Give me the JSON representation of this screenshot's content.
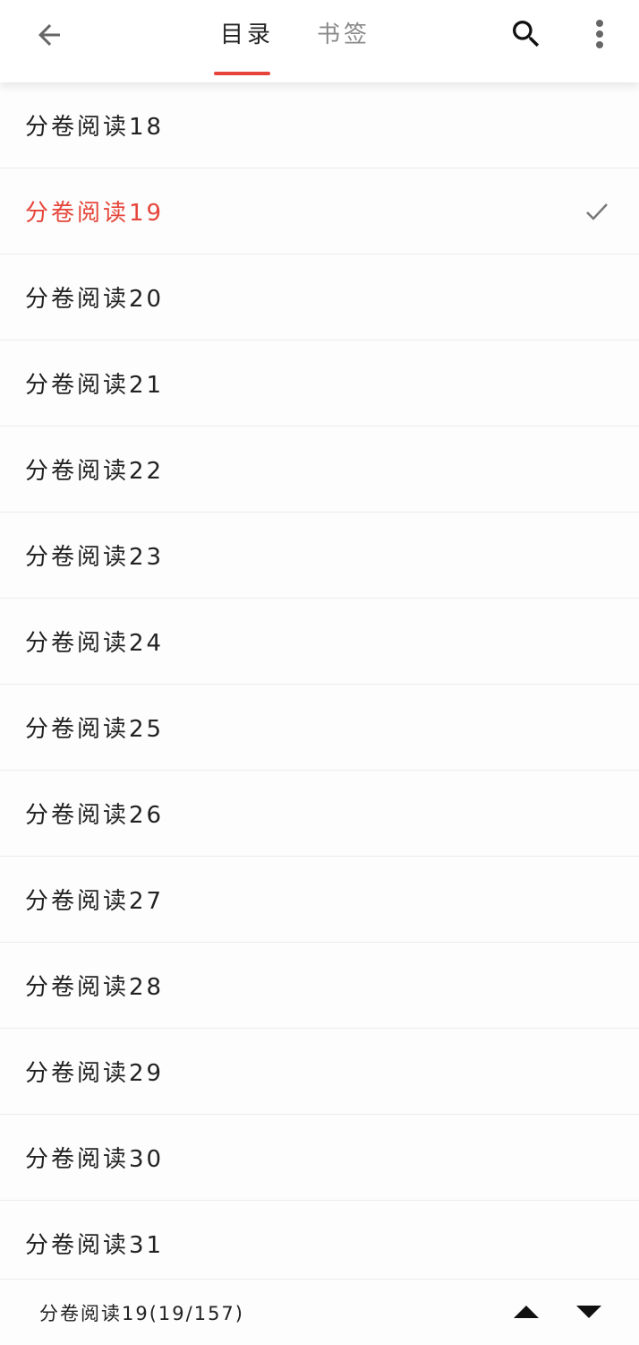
{
  "header": {
    "back_icon": "arrow-left-icon",
    "tabs": [
      {
        "label": "目录",
        "active": true
      },
      {
        "label": "书签",
        "active": false
      }
    ],
    "search_icon": "search-icon",
    "more_icon": "more-vertical-icon"
  },
  "chapters": {
    "items": [
      {
        "label": "分卷阅读18"
      },
      {
        "label": "分卷阅读19",
        "current": true
      },
      {
        "label": "分卷阅读20"
      },
      {
        "label": "分卷阅读21"
      },
      {
        "label": "分卷阅读22"
      },
      {
        "label": "分卷阅读23"
      },
      {
        "label": "分卷阅读24"
      },
      {
        "label": "分卷阅读25"
      },
      {
        "label": "分卷阅读26"
      },
      {
        "label": "分卷阅读27"
      },
      {
        "label": "分卷阅读28"
      },
      {
        "label": "分卷阅读29"
      },
      {
        "label": "分卷阅读30"
      },
      {
        "label": "分卷阅读31"
      }
    ],
    "current_marker_icon": "check-icon"
  },
  "footer": {
    "current_text": "分卷阅读19(19/157)",
    "up_icon": "triangle-up-icon",
    "down_icon": "triangle-down-icon"
  },
  "colors": {
    "accent": "#e5453a",
    "text": "#222222",
    "muted": "#8a8a8a"
  }
}
